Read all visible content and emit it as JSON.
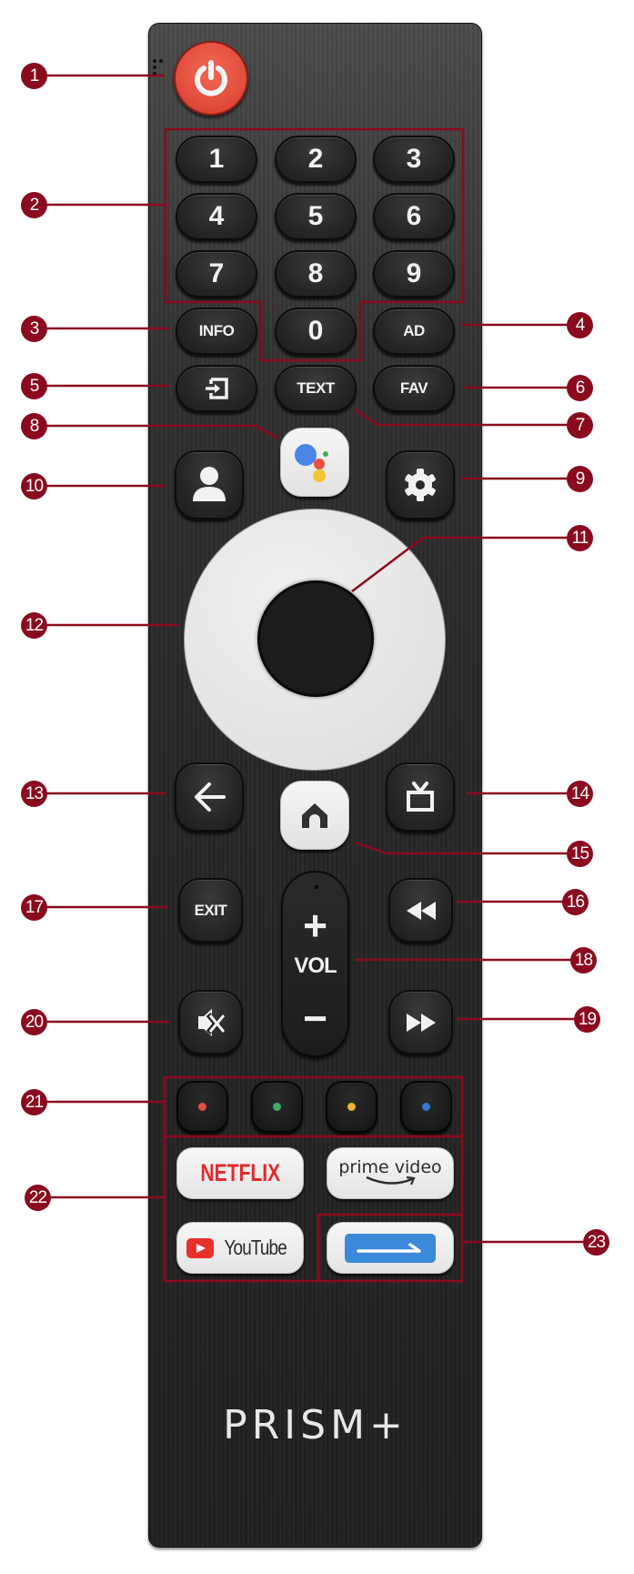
{
  "remote": {
    "brand_logo": "PRISM+",
    "body_color": "#262626",
    "accent_color": "#8a0a1e"
  },
  "buttons": {
    "power": {
      "icon": "power-icon",
      "color": "#e24b3b"
    },
    "numbers": [
      "1",
      "2",
      "3",
      "4",
      "5",
      "6",
      "7",
      "8",
      "9",
      "0"
    ],
    "info": "INFO",
    "ad": "AD",
    "input": {
      "icon": "input-source-icon"
    },
    "text": "TEXT",
    "fav": "FAV",
    "assistant": {
      "icon": "google-assistant-icon"
    },
    "profile": {
      "icon": "user-profile-icon"
    },
    "settings": {
      "icon": "gear-icon"
    },
    "ok": {
      "icon": "ok-center"
    },
    "dpad": {
      "icon": "navigation-ring"
    },
    "back": {
      "icon": "arrow-left-icon"
    },
    "live_tv": {
      "icon": "tv-icon"
    },
    "home": {
      "icon": "home-icon"
    },
    "exit": "EXIT",
    "rewind": {
      "icon": "rewind-icon"
    },
    "volume": {
      "plus": "+",
      "label": "VOL",
      "minus": "−"
    },
    "mute": {
      "icon": "mute-icon"
    },
    "fast_forward": {
      "icon": "fast-forward-icon"
    },
    "color_keys": [
      {
        "name": "red",
        "color": "#e0523f"
      },
      {
        "name": "green",
        "color": "#3fae6b"
      },
      {
        "name": "yellow",
        "color": "#e8b630"
      },
      {
        "name": "blue",
        "color": "#3577d4"
      }
    ],
    "apps": {
      "netflix": "NETFLIX",
      "prime": "prime video",
      "youtube": "YouTube",
      "custom": {
        "icon": "app-shortcut-icon",
        "color": "#3a8ad9"
      }
    }
  },
  "callouts": [
    "1",
    "2",
    "3",
    "4",
    "5",
    "6",
    "7",
    "8",
    "9",
    "10",
    "11",
    "12",
    "13",
    "14",
    "15",
    "16",
    "17",
    "18",
    "19",
    "20",
    "21",
    "22",
    "23"
  ]
}
